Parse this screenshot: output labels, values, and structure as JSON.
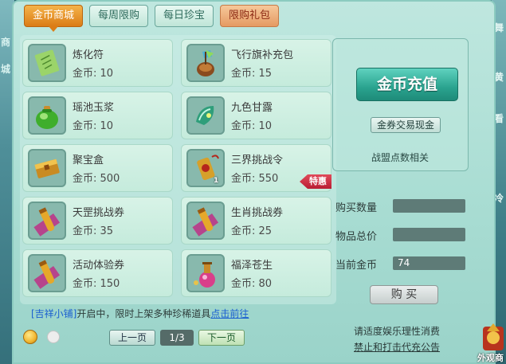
{
  "tabs": [
    {
      "label": "金币商城",
      "active": true
    },
    {
      "label": "每周限购",
      "active": false
    },
    {
      "label": "每日珍宝",
      "active": false
    },
    {
      "label": "限购礼包",
      "active": false
    }
  ],
  "items": [
    {
      "name": "炼化符",
      "price": "金币: 10",
      "icon": "talisman-icon"
    },
    {
      "name": "飞行旗补充包",
      "price": "金币: 15",
      "icon": "flag-pack-icon"
    },
    {
      "name": "瑶池玉浆",
      "price": "金币: 10",
      "icon": "jade-liquid-icon"
    },
    {
      "name": "九色甘露",
      "price": "金币: 10",
      "icon": "nectar-icon"
    },
    {
      "name": "聚宝盒",
      "price": "金币: 500",
      "icon": "treasure-box-icon"
    },
    {
      "name": "三界挑战令",
      "price": "金币: 550",
      "icon": "challenge-token-icon",
      "qty": "1",
      "badge": "特惠"
    },
    {
      "name": "天罡挑战券",
      "price": "金币: 35",
      "icon": "scroll-icon"
    },
    {
      "name": "生肖挑战券",
      "price": "金币: 25",
      "icon": "scroll-icon"
    },
    {
      "name": "活动体验券",
      "price": "金币: 150",
      "icon": "scroll-icon"
    },
    {
      "name": "福泽苍生",
      "price": "金币: 80",
      "icon": "potion-icon"
    }
  ],
  "info_bar": {
    "shop_name": "[吉祥小铺]",
    "middle_text": "开启中，限时上架多种珍稀道具",
    "link_text": "点击前往"
  },
  "pager": {
    "prev_label": "上一页",
    "page": "1/3",
    "next_label": "下一页"
  },
  "right_panel": {
    "recharge_label": "金币充值",
    "exchange_label": "金券交易现金",
    "alliance_label": "战盟点数相关"
  },
  "purchase": {
    "qty_label": "购买数量",
    "qty_value": "",
    "total_label": "物品总价",
    "total_value": "",
    "balance_label": "当前金币",
    "balance_value": "74",
    "buy_label": "购 买"
  },
  "notice": {
    "line1": "请适度娱乐理性消费",
    "line2": "禁止和打击代充公告"
  },
  "outfit_label": "外观商",
  "edge_left": [
    "商",
    "城"
  ],
  "edge_right": [
    "舞",
    "黄",
    "看",
    "冷"
  ],
  "colors": {
    "active_tab": "#db7c16",
    "recharge": "#2aa38f",
    "badge": "#b91d33",
    "link": "#1a5fd0"
  }
}
